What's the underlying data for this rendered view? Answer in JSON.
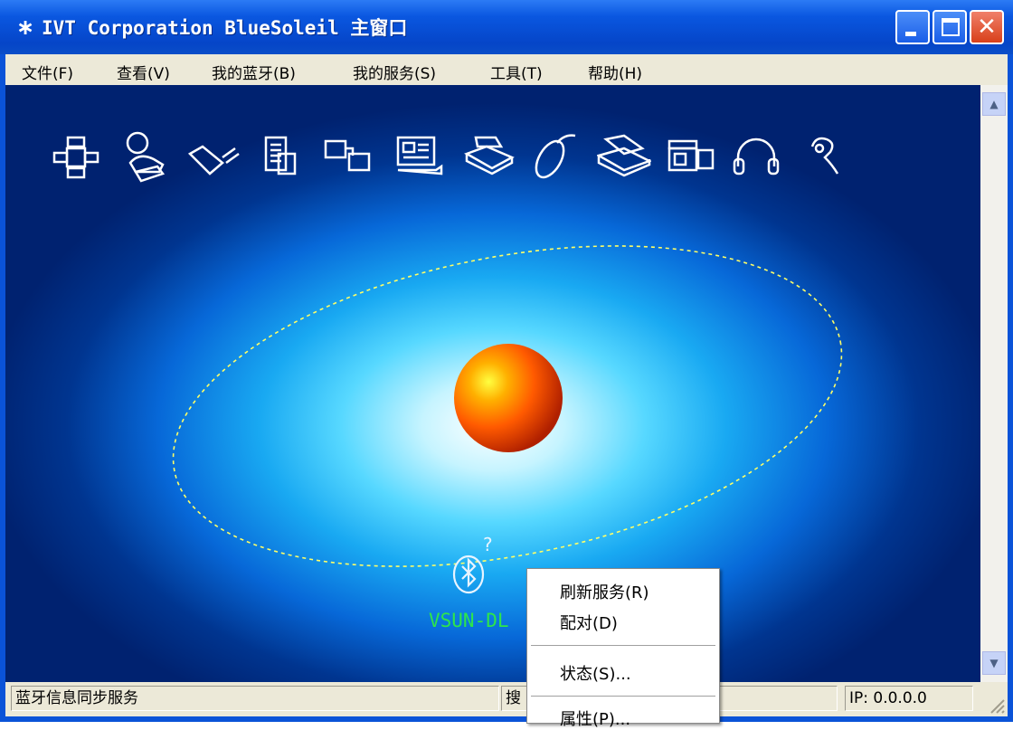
{
  "window": {
    "title": "IVT Corporation BlueSoleil 主窗口",
    "title_icon": "bluetooth-icon",
    "controls": [
      "minimize",
      "maximize",
      "close"
    ]
  },
  "menu": [
    "文件(F)",
    "查看(V)",
    "我的蓝牙(B)",
    "我的服务(S)",
    "工具(T)",
    "帮助(H)"
  ],
  "services": [
    "network-access-icon",
    "dialup-networking-icon",
    "serial-port-icon",
    "object-push-icon",
    "file-transfer-icon",
    "personal-area-network-icon",
    "printer-icon",
    "mouse-icon",
    "fax-icon",
    "camera-icon",
    "headset-icon",
    "earpiece-icon"
  ],
  "device": {
    "name": "VSUN-DL",
    "icon": "bluetooth-device-unknown-icon"
  },
  "context_menu": {
    "items": [
      {
        "label": "刷新服务(R)"
      },
      {
        "label": "配对(D)"
      },
      {
        "label": "状态(S)..."
      },
      {
        "label": "属性(P)..."
      }
    ]
  },
  "status": {
    "left": "蓝牙信息同步服务",
    "middle": "搜",
    "ip": "IP: 0.0.0.0"
  },
  "colors": {
    "titlebar": "#0a55d8",
    "device_label": "#2ee64a",
    "orbit": "#ffff66",
    "sphere": "#ff5a00"
  }
}
